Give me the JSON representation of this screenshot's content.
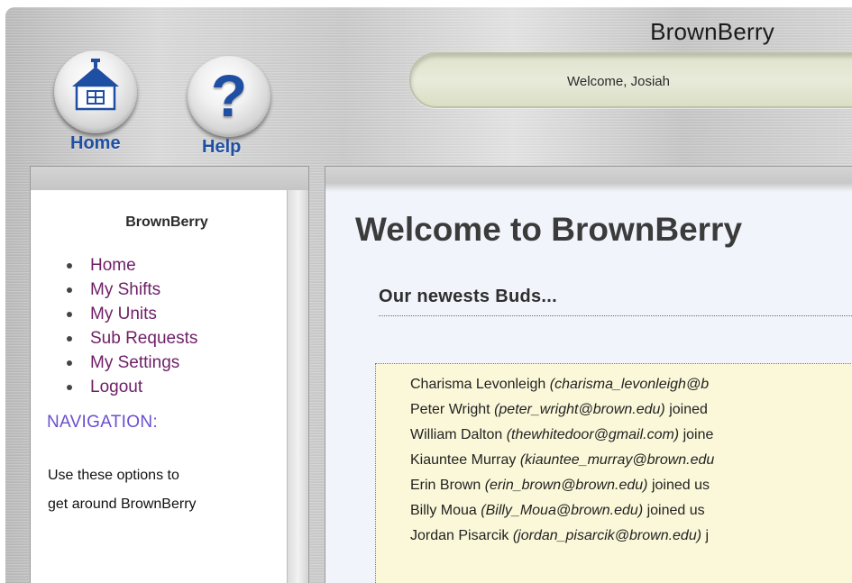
{
  "header": {
    "app_title": "BrownBerry",
    "welcome": "Welcome, Josiah",
    "home_label": "Home",
    "help_label": "Help",
    "help_glyph": "?"
  },
  "sidebar": {
    "title": "BrownBerry",
    "items": [
      {
        "label": "Home"
      },
      {
        "label": "My Shifts"
      },
      {
        "label": "My Units"
      },
      {
        "label": "Sub Requests"
      },
      {
        "label": "My Settings"
      },
      {
        "label": "Logout"
      }
    ],
    "nav_heading": "NAVIGATION:",
    "nav_help_line1": "Use these options to",
    "nav_help_line2": "get around BrownBerry"
  },
  "main": {
    "title": "Welcome to BrownBerry",
    "subtitle": "Our newests Buds...",
    "buds": [
      {
        "name": "Charisma Levonleigh",
        "email": "(charisma_levonleigh@b",
        "suffix": ""
      },
      {
        "name": "Peter Wright",
        "email": "(peter_wright@brown.edu)",
        "suffix": "joined"
      },
      {
        "name": "William Dalton",
        "email": "(thewhitedoor@gmail.com)",
        "suffix": "joine"
      },
      {
        "name": "Kiauntee Murray",
        "email": "(kiauntee_murray@brown.edu",
        "suffix": ""
      },
      {
        "name": "Erin Brown",
        "email": "(erin_brown@brown.edu)",
        "suffix": "joined us"
      },
      {
        "name": "Billy Moua",
        "email": "(Billy_Moua@brown.edu)",
        "suffix": "joined us"
      },
      {
        "name": "Jordan Pisarcik",
        "email": "(jordan_pisarcik@brown.edu)",
        "suffix": "j"
      }
    ]
  },
  "colors": {
    "nav_link": "#6e1e66",
    "nav_heading": "#6a4fd0",
    "button_label": "#1f4fa3",
    "buds_bg": "#fbf8d9",
    "content_bg": "#f1f5fb"
  },
  "icons": {
    "home": "house-icon",
    "help": "question-mark-icon"
  }
}
